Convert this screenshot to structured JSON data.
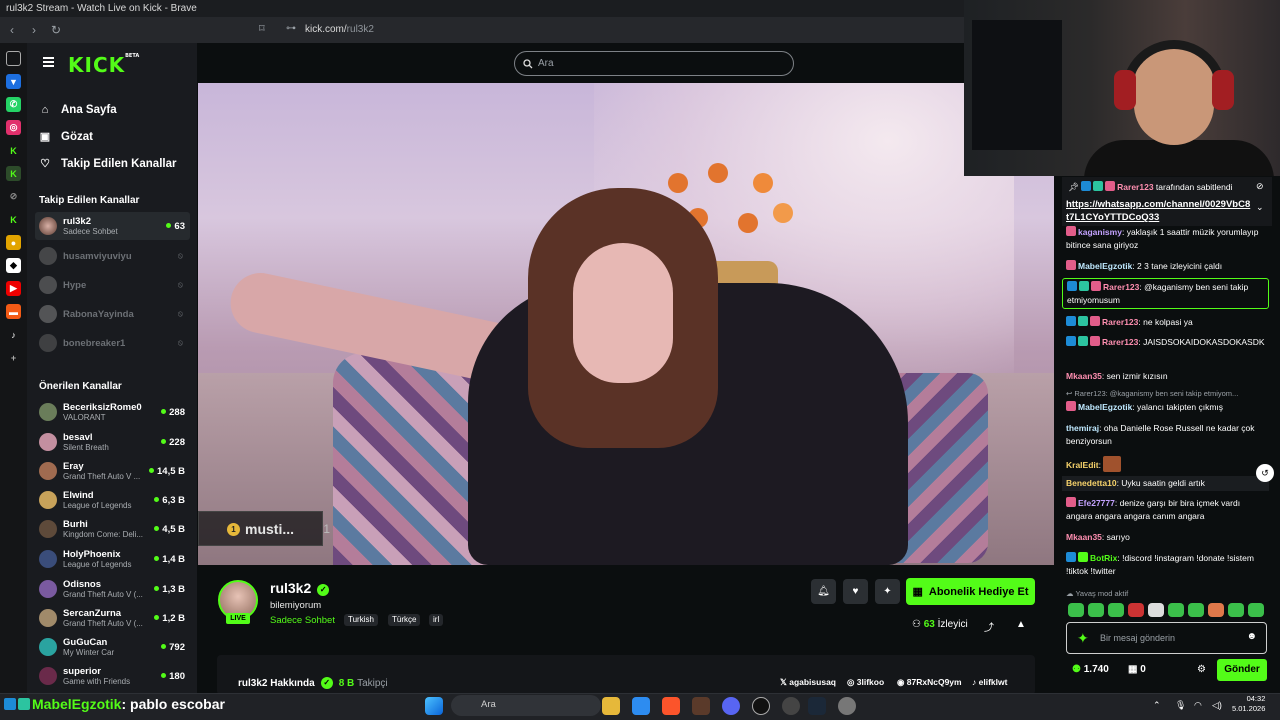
{
  "window": {
    "title": "rul3k2 Stream - Watch Live on Kick - Brave"
  },
  "browser": {
    "url_host": "kick.com/",
    "url_path": "rul3k2"
  },
  "kick": {
    "logo": "KICK",
    "logo_beta": "BETA",
    "search_placeholder": "Ara",
    "nav": [
      {
        "label": "Ana Sayfa",
        "icon": "home-icon"
      },
      {
        "label": "Gözat",
        "icon": "browse-icon"
      },
      {
        "label": "Takip Edilen Kanallar",
        "icon": "heart-icon"
      }
    ],
    "followed_title": "Takip Edilen Kanallar",
    "followed": [
      {
        "name": "rul3k2",
        "game": "Sadece Sohbet",
        "viewers": "63",
        "live": true
      },
      {
        "name": "husamviyuviyu",
        "game": "",
        "viewers": "",
        "live": false
      },
      {
        "name": "Hype",
        "game": "",
        "viewers": "",
        "live": false
      },
      {
        "name": "RabonaYayinda",
        "game": "",
        "viewers": "",
        "live": false
      },
      {
        "name": "bonebreaker1",
        "game": "",
        "viewers": "",
        "live": false
      }
    ],
    "recommended_title": "Önerilen Kanallar",
    "recommended": [
      {
        "name": "BeceriksizRome0",
        "game": "VALORANT",
        "viewers": "288"
      },
      {
        "name": "besavl",
        "game": "Silent Breath",
        "viewers": "228"
      },
      {
        "name": "Eray",
        "game": "Grand Theft Auto V ...",
        "viewers": "14,5 B"
      },
      {
        "name": "Elwind",
        "game": "League of Legends",
        "viewers": "6,3 B"
      },
      {
        "name": "Burhi",
        "game": "Kingdom Come: Deli...",
        "viewers": "4,5 B"
      },
      {
        "name": "HolyPhoenix",
        "game": "League of Legends",
        "viewers": "1,4 B"
      },
      {
        "name": "Odisnos",
        "game": "Grand Theft Auto V (...",
        "viewers": "1,3 B"
      },
      {
        "name": "SercanZurna",
        "game": "Grand Theft Auto V (...",
        "viewers": "1,2 B"
      },
      {
        "name": "GuGuCan",
        "game": "My Winter Car",
        "viewers": "792"
      },
      {
        "name": "superior",
        "game": "Game with Friends",
        "viewers": "180"
      }
    ]
  },
  "video_overlay": {
    "name": "musti...",
    "count": "1"
  },
  "stream": {
    "streamer": "rul3k2",
    "title": "bilemiyorum",
    "category": "Sadece Sohbet",
    "tags": [
      "Turkish",
      "Türkçe",
      "irl"
    ],
    "live_label": "LIVE",
    "gift_label": "Abonelik Hediye Et",
    "viewers": "63",
    "viewers_label": "İzleyici",
    "about_title": "rul3k2 Hakkında",
    "followers": "8 B",
    "followers_label": "Takipçi",
    "socials": [
      "agabisusaq",
      "3lifkoo",
      "87RxNcQ9ym",
      "elifklwt"
    ]
  },
  "chat": {
    "pinned_by": "Rarer123",
    "pinned_suffix": "tarafından sabitlendi",
    "pinned_link": "https://whatsapp.com/channel/0029VbC8t7L1CYoYTTDCoQ33",
    "messages": [
      {
        "user": "kaganismy",
        "color": "#c3a2ff",
        "text": "yaklaşık 1 saattir müzik yorumlayıp bitince sana giriyoz"
      },
      {
        "user": "MabelEgzotik",
        "color": "#bfe9ff",
        "text": "2 3 tane izleyicini çaldı"
      },
      {
        "user": "Rarer123",
        "color": "#ff8fb1",
        "text": "@kaganismy ben seni takip etmiyomusum"
      },
      {
        "user": "Rarer123",
        "color": "#ff8fb1",
        "text": "ne kolpasi ya"
      },
      {
        "user": "Rarer123",
        "color": "#ff8fb1",
        "text": "JAISDSOKAIDOKASDOKASDK"
      },
      {
        "user": "Mkaan35",
        "color": "#ff8fb1",
        "text": "sen izmir kızısın"
      },
      {
        "user": "MabelEgzotik",
        "color": "#bfe9ff",
        "text": "yalancı takipten çıkmış"
      },
      {
        "user": "themiraj",
        "color": "#bfe9ff",
        "text": "oha Danielle Rose Russell ne kadar çok benziyorsun"
      },
      {
        "user": "KralEdit",
        "color": "#f7d36b",
        "text": ""
      },
      {
        "user": "Benedetta10",
        "color": "#f7d36b",
        "text": "Uyku saatin geldi artık"
      },
      {
        "user": "Efe27777",
        "color": "#c3a2ff",
        "text": "denize garşı bir bira içmek vardı angara angara angara canım angara"
      },
      {
        "user": "Mkaan35",
        "color": "#ff8fb1",
        "text": "sarıyo"
      },
      {
        "user": "BotRix",
        "color": "#53fc18",
        "text": "!discord !instagram !donate !sistem !tiktok !twitter"
      }
    ],
    "reply_preview": "Rarer123: @kaganismy ben seni takip etmiyom...",
    "slow_mode": "Yavaş mod aktif",
    "input_placeholder": "Bir mesaj gönderin",
    "points": "1.740",
    "gifts": "0",
    "send_label": "Gönder"
  },
  "taskbar": {
    "overlay_user": "MabelEgzotik",
    "overlay_text": ": pablo escobar",
    "search": "Ara",
    "time": "04:32",
    "date": "5.01.2026"
  }
}
